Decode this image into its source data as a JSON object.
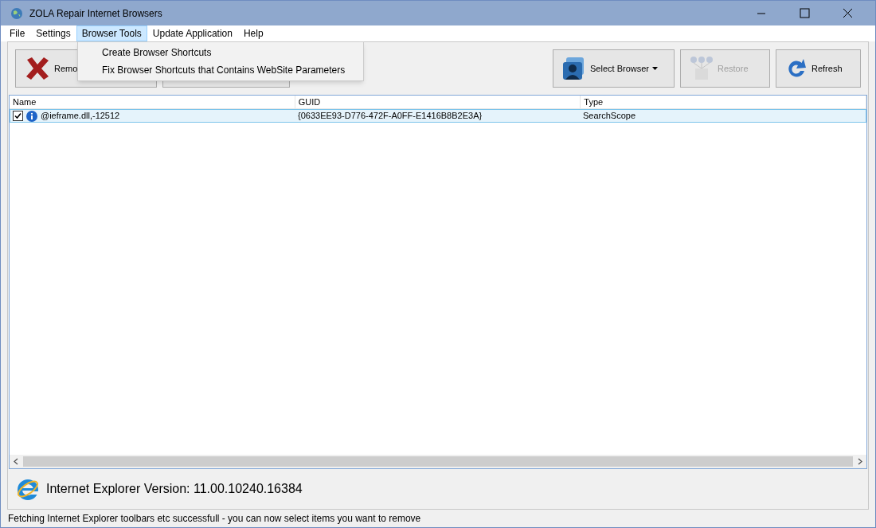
{
  "window": {
    "title": "ZOLA Repair Internet Browsers"
  },
  "menu": [
    {
      "label": "File",
      "selected": false
    },
    {
      "label": "Settings",
      "selected": false
    },
    {
      "label": "Browser Tools",
      "selected": true
    },
    {
      "label": "Update Application",
      "selected": false
    },
    {
      "label": "Help",
      "selected": false
    }
  ],
  "dropdown": [
    "Create Browser Shortcuts",
    "Fix Browser Shortcuts that Contains WebSite Parameters"
  ],
  "toolbar_left": [
    {
      "kind": "remove",
      "label": "Remo"
    },
    {
      "kind": "blank"
    }
  ],
  "toolbar_right": [
    {
      "kind": "select",
      "label": "Select Browser",
      "disabled": false
    },
    {
      "kind": "restore",
      "label": "Restore",
      "disabled": true
    },
    {
      "kind": "refresh",
      "label": "Refresh",
      "disabled": false
    }
  ],
  "table": {
    "columns": [
      "Name",
      "GUID",
      "Type"
    ],
    "rows": [
      {
        "checked": true,
        "selected": true,
        "cells": [
          "@ieframe.dll,-12512",
          "{0633EE93-D776-472F-A0FF-E1416B8B2E3A}",
          "SearchScope"
        ]
      }
    ]
  },
  "version": "Internet Explorer Version: 11.00.10240.16384",
  "status_bar": "Fetching Internet Explorer toolbars etc successfull - you can now select items you want to remove"
}
